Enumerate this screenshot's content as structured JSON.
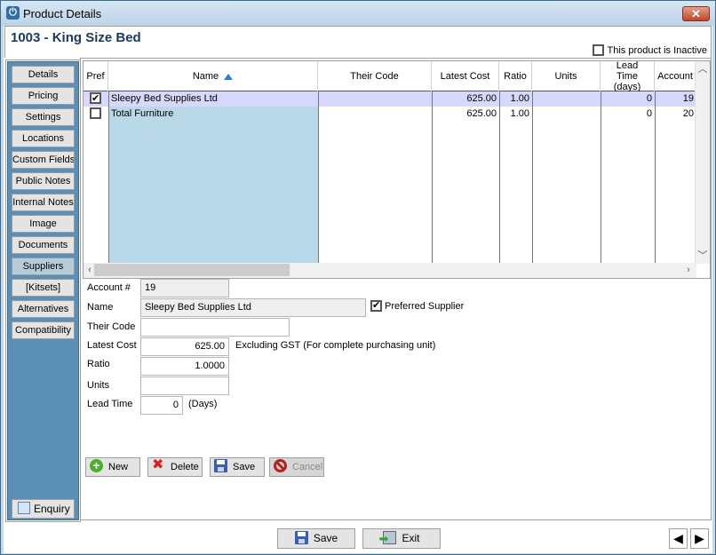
{
  "window": {
    "title": "Product Details",
    "close_icon": "close-icon"
  },
  "header": {
    "product_title": "1003 - King Size Bed",
    "inactive_label": "This product is Inactive",
    "inactive_checked": false
  },
  "sidebar": {
    "items": [
      {
        "label": "Details"
      },
      {
        "label": "Pricing"
      },
      {
        "label": "Settings"
      },
      {
        "label": "Locations"
      },
      {
        "label": "Custom Fields"
      },
      {
        "label": "Public Notes"
      },
      {
        "label": "Internal Notes"
      },
      {
        "label": "Image"
      },
      {
        "label": "Documents"
      },
      {
        "label": "Suppliers",
        "active": true
      },
      {
        "label": "[Kitsets]"
      },
      {
        "label": "Alternatives"
      },
      {
        "label": "Compatibility"
      }
    ],
    "enquiry_label": "Enquiry"
  },
  "grid": {
    "columns": [
      "Pref",
      "Name",
      "Their Code",
      "Latest Cost",
      "Ratio",
      "Units",
      "Lead Time (days)",
      "Account"
    ],
    "sort_column": "Name",
    "sort_direction": "ascending",
    "rows": [
      {
        "pref": true,
        "name": "Sleepy Bed Supplies Ltd",
        "their_code": "",
        "latest_cost": "625.00",
        "ratio": "1.00",
        "units": "",
        "lead_time": "0",
        "account": "19",
        "selected": true
      },
      {
        "pref": false,
        "name": "Total Furniture",
        "their_code": "",
        "latest_cost": "625.00",
        "ratio": "1.00",
        "units": "",
        "lead_time": "0",
        "account": "20",
        "selected": false
      }
    ]
  },
  "form": {
    "account_label": "Account #",
    "account_value": "19",
    "name_label": "Name",
    "name_value": "Sleepy Bed Supplies Ltd",
    "preferred_label": "Preferred Supplier",
    "preferred_checked": true,
    "their_code_label": "Their Code",
    "their_code_value": "",
    "latest_cost_label": "Latest Cost",
    "latest_cost_value": "625.00",
    "latest_cost_note": "Excluding GST (For complete purchasing unit)",
    "ratio_label": "Ratio",
    "ratio_value": "1.0000",
    "units_label": "Units",
    "units_value": "",
    "lead_time_label": "Lead Time",
    "lead_time_value": "0",
    "lead_time_unit": "(Days)"
  },
  "actions": {
    "new_label": "New",
    "delete_label": "Delete",
    "save_label": "Save",
    "cancel_label": "Cancel"
  },
  "footer": {
    "save_label": "Save",
    "exit_label": "Exit",
    "prev_icon": "◀",
    "next_icon": "▶"
  }
}
